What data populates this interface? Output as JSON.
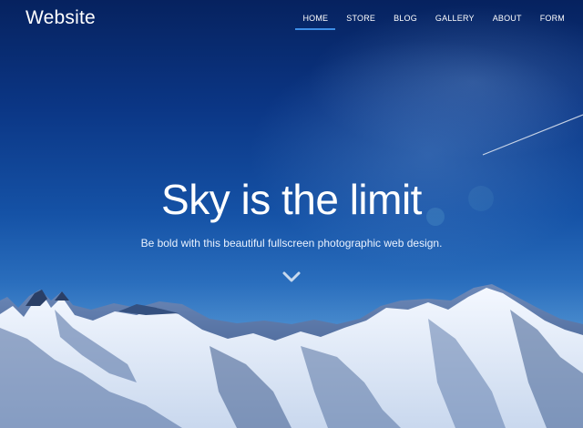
{
  "brand": {
    "name": "Website"
  },
  "nav": {
    "items": [
      {
        "label": "HOME",
        "active": true
      },
      {
        "label": "STORE",
        "active": false
      },
      {
        "label": "BLOG",
        "active": false
      },
      {
        "label": "GALLERY",
        "active": false
      },
      {
        "label": "ABOUT",
        "active": false
      },
      {
        "label": "FORM",
        "active": false
      }
    ],
    "active_color": "#3d8ee6"
  },
  "hero": {
    "headline": "Sky is the limit",
    "tagline": "Be bold with this beautiful fullscreen photographic web design.",
    "scroll_icon": "chevron-down-icon"
  }
}
